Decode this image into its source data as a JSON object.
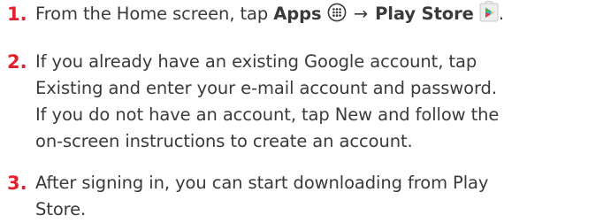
{
  "accent_color": "#e3202d",
  "text_color": "#3a3a3a",
  "steps": [
    {
      "number": "1.",
      "lines": [
        {
          "before": "From the Home screen, tap ",
          "bold1": "Apps",
          "icon1": "apps-grid-icon",
          "arrow": "→",
          "bold2": "Play Store",
          "icon2": "play-store-icon",
          "after": "."
        }
      ]
    },
    {
      "number": "2.",
      "lines": [
        "If you already have an existing Google account, tap",
        "Existing and enter your e-mail account and password.",
        "If you do not have an account, tap New and follow the",
        "on-screen instructions to create an account."
      ]
    },
    {
      "number": "3.",
      "lines": [
        "After signing in, you can start downloading from Play",
        "Store."
      ]
    }
  ]
}
